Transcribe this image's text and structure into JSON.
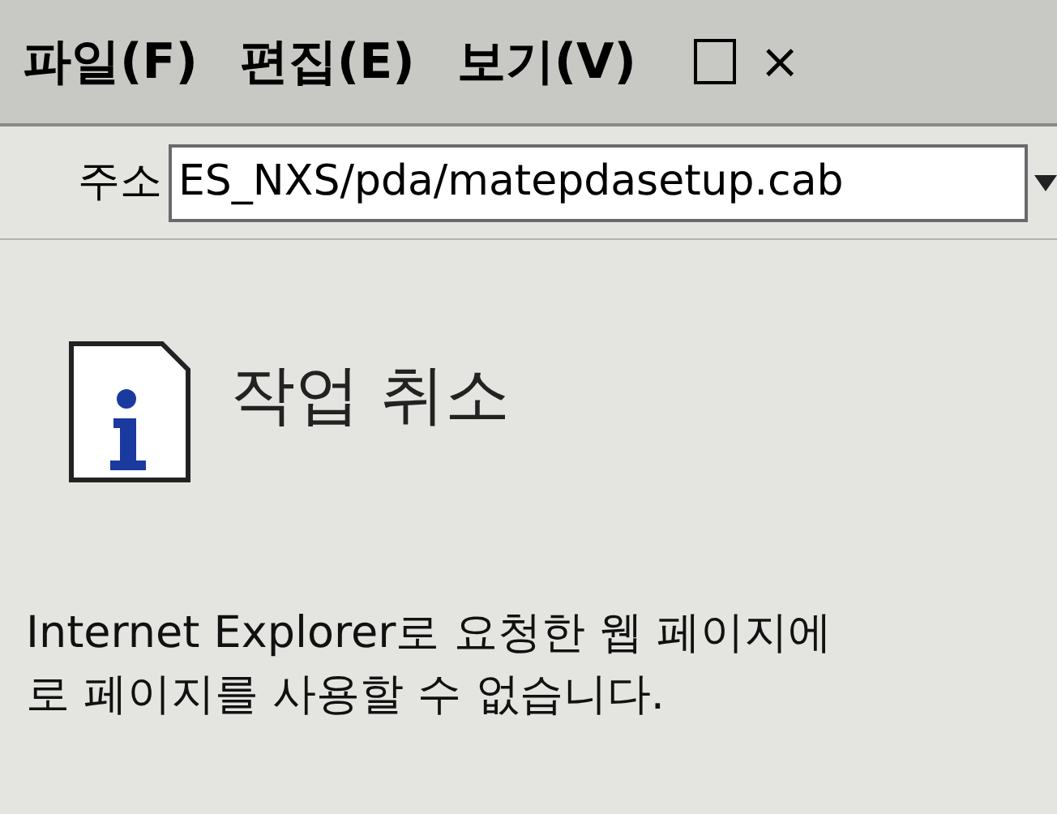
{
  "menu_bar": {
    "items": [
      "파일(F)",
      "편집(E)",
      "보기(V)"
    ],
    "close": "×"
  },
  "address_bar": {
    "label": "주소",
    "value": "ES_NXS/pda/matepdasetup.cab"
  },
  "page": {
    "title": "작업 취소",
    "message_lines": [
      "Internet Explorer로 요청한 웹 페이지에",
      "로 페이지를 사용할 수 없습니다."
    ]
  }
}
